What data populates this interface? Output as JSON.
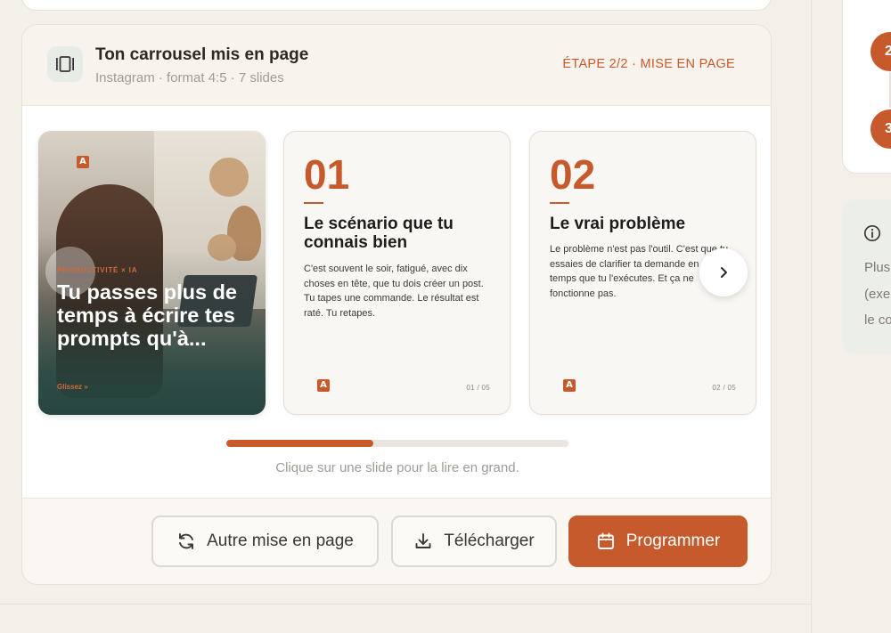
{
  "carousel": {
    "title": "Ton carrousel mis en page",
    "subtitle": "Instagram · format 4:5 · 7 slides",
    "step": "ÉTAPE 2/2 · MISE EN PAGE",
    "progress": 0.43,
    "hint": "Clique sur une slide pour la lire en grand."
  },
  "cover_slide": {
    "brand": "A",
    "kicker": "PRODUCTIVITÉ × IA",
    "title": "Tu passes plus de temps à écrire tes prompts qu'à...",
    "cta": "Glissez »"
  },
  "slides": [
    {
      "number": "01",
      "title": "Le scénario que tu connais bien",
      "body": "C'est souvent le soir, fatigué, avec dix choses en tête, que tu dois créer un post. Tu tapes une commande. Le résultat est raté. Tu retapes.",
      "brand": "A",
      "page": "01 / 05"
    },
    {
      "number": "02",
      "title": "Le vrai problème",
      "body": "Le problème n'est pas l'outil. C'est que tu essaies de clarifier ta demande en même temps que tu l'exécutes. Et ça ne fonctionne pas.",
      "brand": "A",
      "page": "02 / 05"
    }
  ],
  "actions": {
    "relayout": "Autre mise en page",
    "download": "Télécharger",
    "schedule": "Programmer"
  },
  "right_panel": {
    "steps": [
      "2",
      "3"
    ],
    "info_lines": [
      "Plus",
      "(exe",
      "le co"
    ]
  },
  "colors": {
    "accent": "#c65a2c",
    "background": "#f3efe9"
  },
  "icons": {
    "carousel": "carousel-layout-icon",
    "next": "chevron-right-icon",
    "relayout": "refresh-icon",
    "download": "download-icon",
    "schedule": "calendar-icon",
    "info": "info-icon"
  }
}
